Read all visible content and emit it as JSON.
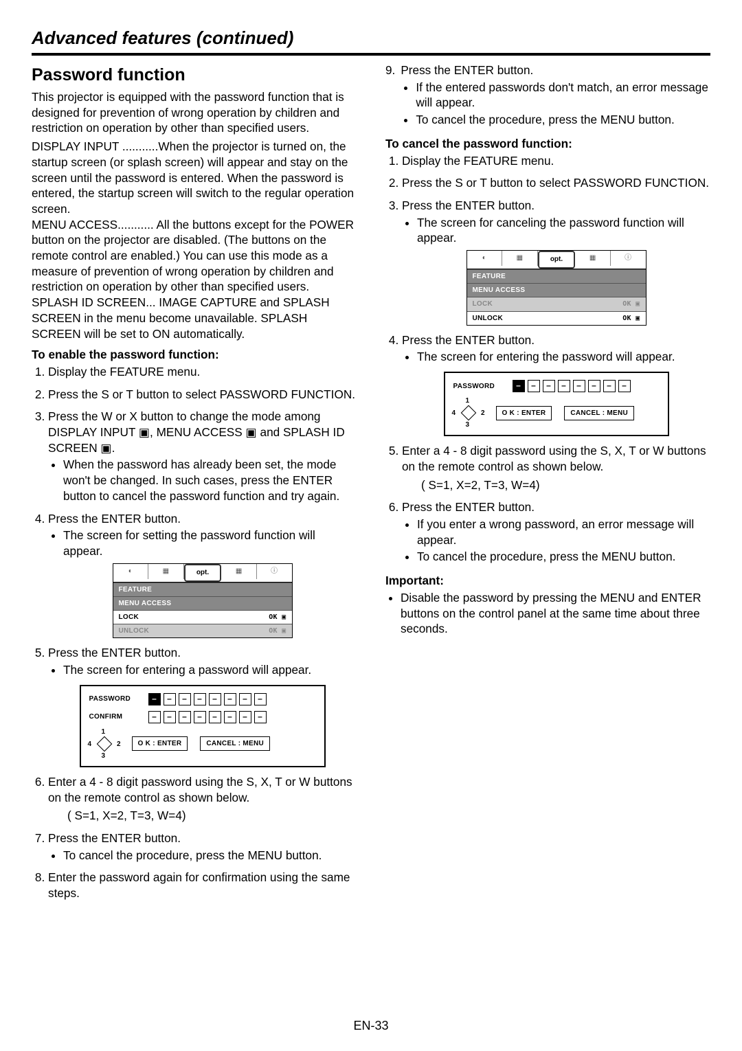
{
  "header": {
    "section_title": "Advanced features (continued)"
  },
  "left": {
    "h2": "Password function",
    "intro": "This projector is equipped with the password function that is designed for prevention of wrong operation by children and restriction on operation by other than specified users.",
    "defs": [
      {
        "term": "DISPLAY INPUT ...........",
        "desc": "When the projector is turned on, the startup screen (or splash screen) will appear and stay on the screen until the password is entered. When the password is entered, the startup screen will switch to the regular operation screen."
      },
      {
        "term": "MENU ACCESS........... ",
        "desc": "All the buttons except for the POWER button on the projector are disabled. (The buttons on the remote control are enabled.) You can use this mode as a measure of prevention of wrong operation by children and restriction on operation by other than specified users."
      },
      {
        "term": "SPLASH ID SCREEN... ",
        "desc": "IMAGE CAPTURE and SPLASH SCREEN in the menu become unavailable. SPLASH SCREEN will be set to ON automatically."
      }
    ],
    "enable_title": "To enable the password function:",
    "enable_steps": [
      {
        "text": "Display the FEATURE menu."
      },
      {
        "text": "Press the  S or  T button to select PASSWORD FUNCTION."
      },
      {
        "text": "Press the  W or X button to change the mode among DISPLAY INPUT ▣, MENU ACCESS ▣ and SPLASH ID SCREEN ▣.",
        "sub": [
          "When the password has already been set, the mode won't be changed. In such cases, press the ENTER button to cancel the password function and try again."
        ]
      },
      {
        "text": "Press the ENTER button.",
        "sub": [
          "The screen for setting the password function will appear."
        ]
      },
      {
        "text": "Press the ENTER button.",
        "sub": [
          "The screen for entering a password will appear."
        ]
      },
      {
        "text": "Enter a 4 - 8 digit password using the  S,  X,  T  or W buttons on the remote control as shown below.",
        "tail": "( S=1,  X=2,  T=3,  W=4)"
      },
      {
        "text": "Press the ENTER button.",
        "sub": [
          "To cancel the procedure, press the MENU button."
        ]
      },
      {
        "text": "Enter the password again for confirmation using the same steps."
      }
    ],
    "osd_lock": {
      "tabs_opt": "opt.",
      "feature": "FEATURE",
      "menu_access": "MENU ACCESS",
      "lock": "LOCK",
      "unlock": "UNLOCK",
      "ok": "OK ▣"
    },
    "pwd_set": {
      "password": "PASSWORD",
      "confirm": "CONFIRM",
      "ok": "O K : ENTER",
      "cancel": "CANCEL : MENU",
      "d1": "1",
      "d2": "2",
      "d3": "3",
      "d4": "4"
    }
  },
  "right": {
    "steps_cont": [
      {
        "n": "9.",
        "text": "Press the ENTER button.",
        "sub": [
          "If the entered passwords don't match, an error message will appear.",
          "To cancel the procedure, press the MENU button."
        ]
      }
    ],
    "cancel_title": "To cancel the password function:",
    "cancel_steps_a": [
      {
        "text": "Display the FEATURE menu."
      },
      {
        "text": "Press the  S or  T button to select PASSWORD FUNCTION."
      },
      {
        "text": "Press the ENTER button.",
        "sub": [
          "The screen for canceling the password function will appear."
        ]
      }
    ],
    "cancel_steps_b": [
      {
        "text": "Press the ENTER button.",
        "sub": [
          "The screen for entering the password will appear."
        ]
      }
    ],
    "cancel_steps_c": [
      {
        "text": "Enter a 4 - 8 digit password using the  S,  X,  T  or W buttons on the remote control as shown below.",
        "tail": "( S=1,  X=2,  T=3,  W=4)"
      },
      {
        "text": "Press the ENTER button.",
        "sub": [
          "If you enter a wrong password, an error message will appear.",
          "To cancel the procedure, press the MENU button."
        ]
      }
    ],
    "osd_unlock": {
      "tabs_opt": "opt.",
      "feature": "FEATURE",
      "menu_access": "MENU ACCESS",
      "lock": "LOCK",
      "unlock": "UNLOCK",
      "ok": "OK ▣"
    },
    "pwd_cancel": {
      "password": "PASSWORD",
      "ok": "O K : ENTER",
      "cancel": "CANCEL : MENU",
      "d1": "1",
      "d2": "2",
      "d3": "3",
      "d4": "4"
    },
    "important_label": "Important:",
    "important_text": "Disable the password by pressing the MENU and ENTER buttons on the control panel at the same time about three seconds."
  },
  "footer": {
    "page": "EN-33"
  }
}
